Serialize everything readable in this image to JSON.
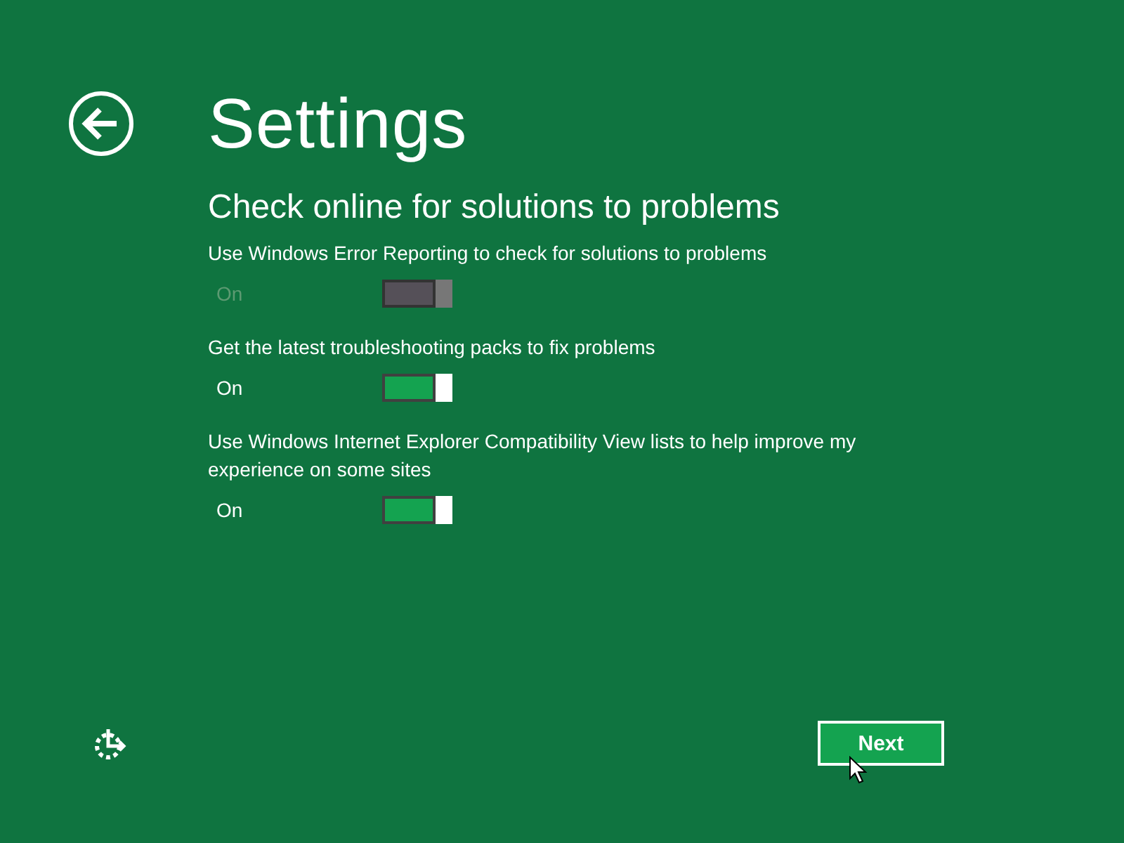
{
  "page": {
    "title": "Settings"
  },
  "section": {
    "heading": "Check online for solutions to problems"
  },
  "settings": [
    {
      "label": "Use Windows Error Reporting to check for solutions to problems",
      "state_text": "On",
      "on": true,
      "disabled": true
    },
    {
      "label": "Get the latest troubleshooting packs to fix problems",
      "state_text": "On",
      "on": true,
      "disabled": false
    },
    {
      "label": "Use Windows Internet Explorer Compatibility View lists to help improve my experience on some sites",
      "state_text": "On",
      "on": true,
      "disabled": false
    }
  ],
  "buttons": [
    {
      "label": "Next"
    }
  ]
}
